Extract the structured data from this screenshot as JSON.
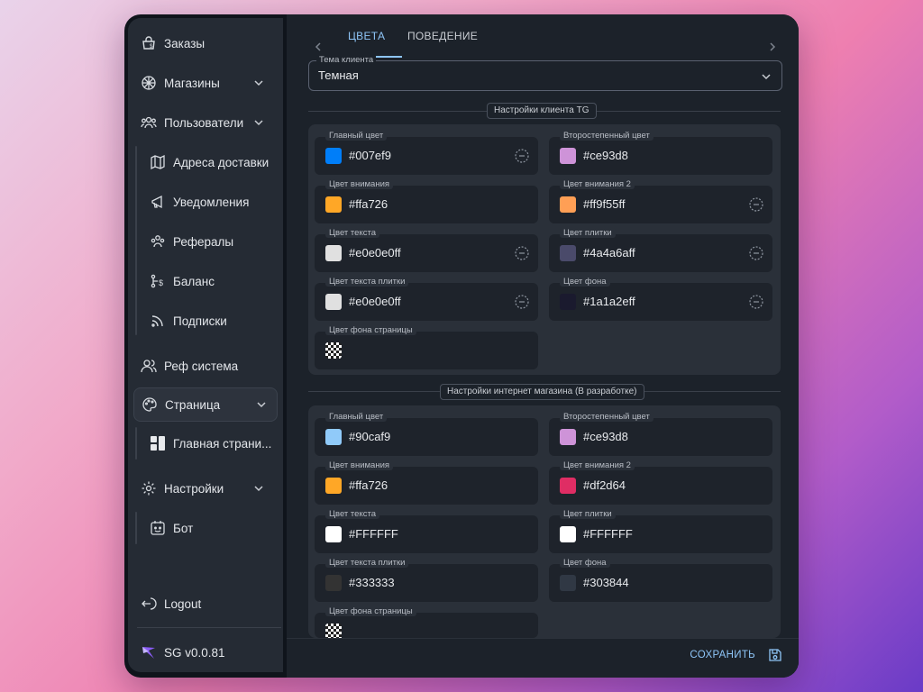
{
  "sidebar": {
    "items": [
      {
        "label": "Заказы",
        "icon": "orders-icon"
      },
      {
        "label": "Магазины",
        "icon": "shops-icon"
      },
      {
        "label": "Пользователи",
        "icon": "users-icon"
      },
      {
        "label": "Реф система",
        "icon": "ref-system-icon"
      },
      {
        "label": "Страница",
        "icon": "palette-icon"
      },
      {
        "label": "Настройки",
        "icon": "gear-icon"
      },
      {
        "label": "Logout",
        "icon": "logout-icon"
      }
    ],
    "user_subitems": [
      {
        "label": "Адреса доставки",
        "icon": "map-icon"
      },
      {
        "label": "Уведомления",
        "icon": "megaphone-icon"
      },
      {
        "label": "Рефералы",
        "icon": "referrals-icon"
      },
      {
        "label": "Баланс",
        "icon": "balance-icon"
      },
      {
        "label": "Подписки",
        "icon": "rss-icon"
      }
    ],
    "page_subitems": [
      {
        "label": "Главная страни...",
        "icon": "dashboard-icon"
      }
    ],
    "settings_subitems": [
      {
        "label": "Бот",
        "icon": "bot-icon"
      }
    ],
    "version": "SG v0.0.81"
  },
  "tabs": [
    {
      "label": "ЦВЕТА",
      "active": true
    },
    {
      "label": "ПОВЕДЕНИЕ",
      "active": false
    }
  ],
  "theme_select": {
    "legend": "Тема клиента",
    "value": "Темная"
  },
  "sections": [
    {
      "title": "Настройки клиента TG",
      "fields": [
        {
          "label": "Главный цвет",
          "value": "#007ef9",
          "color": "#007ef9",
          "clear": true
        },
        {
          "label": "Второстепенный цвет",
          "value": "#ce93d8",
          "color": "#ce93d8",
          "clear": false
        },
        {
          "label": "Цвет внимания",
          "value": "#ffa726",
          "color": "#ffa726",
          "clear": false
        },
        {
          "label": "Цвет внимания 2",
          "value": "#ff9f55ff",
          "color": "#ff9f55",
          "clear": true
        },
        {
          "label": "Цвет текста",
          "value": "#e0e0e0ff",
          "color": "#e0e0e0",
          "clear": true
        },
        {
          "label": "Цвет плитки",
          "value": "#4a4a6aff",
          "color": "#4a4a6a",
          "clear": true
        },
        {
          "label": "Цвет текста плитки",
          "value": "#e0e0e0ff",
          "color": "#e0e0e0",
          "clear": true
        },
        {
          "label": "Цвет фона",
          "value": "#1a1a2eff",
          "color": "#1a1a2e",
          "clear": true
        },
        {
          "label": "Цвет фона страницы",
          "value": "",
          "color": "transparent",
          "clear": false
        }
      ]
    },
    {
      "title": "Настройки интернет магазина (В разработке)",
      "fields": [
        {
          "label": "Главный цвет",
          "value": "#90caf9",
          "color": "#90caf9",
          "clear": false
        },
        {
          "label": "Второстепенный цвет",
          "value": "#ce93d8",
          "color": "#ce93d8",
          "clear": false
        },
        {
          "label": "Цвет внимания",
          "value": "#ffa726",
          "color": "#ffa726",
          "clear": false
        },
        {
          "label": "Цвет внимания 2",
          "value": "#df2d64",
          "color": "#df2d64",
          "clear": false
        },
        {
          "label": "Цвет текста",
          "value": "#FFFFFF",
          "color": "#FFFFFF",
          "clear": false
        },
        {
          "label": "Цвет плитки",
          "value": "#FFFFFF",
          "color": "#FFFFFF",
          "clear": false
        },
        {
          "label": "Цвет текста плитки",
          "value": "#333333",
          "color": "#333333",
          "clear": false
        },
        {
          "label": "Цвет фона",
          "value": "#303844",
          "color": "#303844",
          "clear": false
        },
        {
          "label": "Цвет фона страницы",
          "value": "",
          "color": "transparent",
          "clear": false
        }
      ]
    }
  ],
  "footer": {
    "save_label": "СОХРАНИТЬ",
    "save_icon": "save-icon"
  },
  "colors": {
    "accent": "#8ec5f7",
    "panel": "#2a3039",
    "field": "#1e232b",
    "sidebar": "#252b34"
  }
}
